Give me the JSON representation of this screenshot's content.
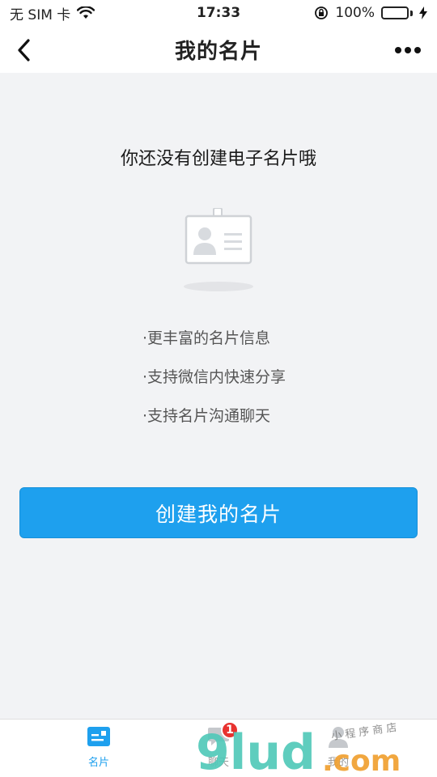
{
  "status_bar": {
    "carrier": "无 SIM 卡",
    "time": "17:33",
    "battery_percent": "100%",
    "battery_level": 1.0,
    "icons": [
      "wifi-icon",
      "rotation-lock-icon",
      "battery-icon",
      "charging-icon"
    ]
  },
  "header": {
    "title": "我的名片",
    "back_icon": "back-chevron-icon",
    "more_icon": "more-dots-icon"
  },
  "empty_state": {
    "title": "你还没有创建电子名片哦",
    "illustration": "business-card-icon",
    "features": [
      "·更丰富的名片信息",
      "·支持微信内快速分享",
      "·支持名片沟通聊天"
    ],
    "button_label": "创建我的名片"
  },
  "tabbar": {
    "tabs": [
      {
        "label": "名片",
        "icon": "card-tab-icon",
        "active": true
      },
      {
        "label": "聊天",
        "icon": "chat-tab-icon",
        "active": false,
        "badge": "1"
      },
      {
        "label": "我的",
        "icon": "profile-tab-icon",
        "active": false
      }
    ]
  },
  "watermark": {
    "brand": "9lud.com",
    "caption": "小程序商店"
  },
  "colors": {
    "accent": "#1ea0ee",
    "background": "#f2f3f5",
    "badge": "#e8322f",
    "watermark_teal": "#52c9b9",
    "watermark_orange": "#f0a030"
  }
}
